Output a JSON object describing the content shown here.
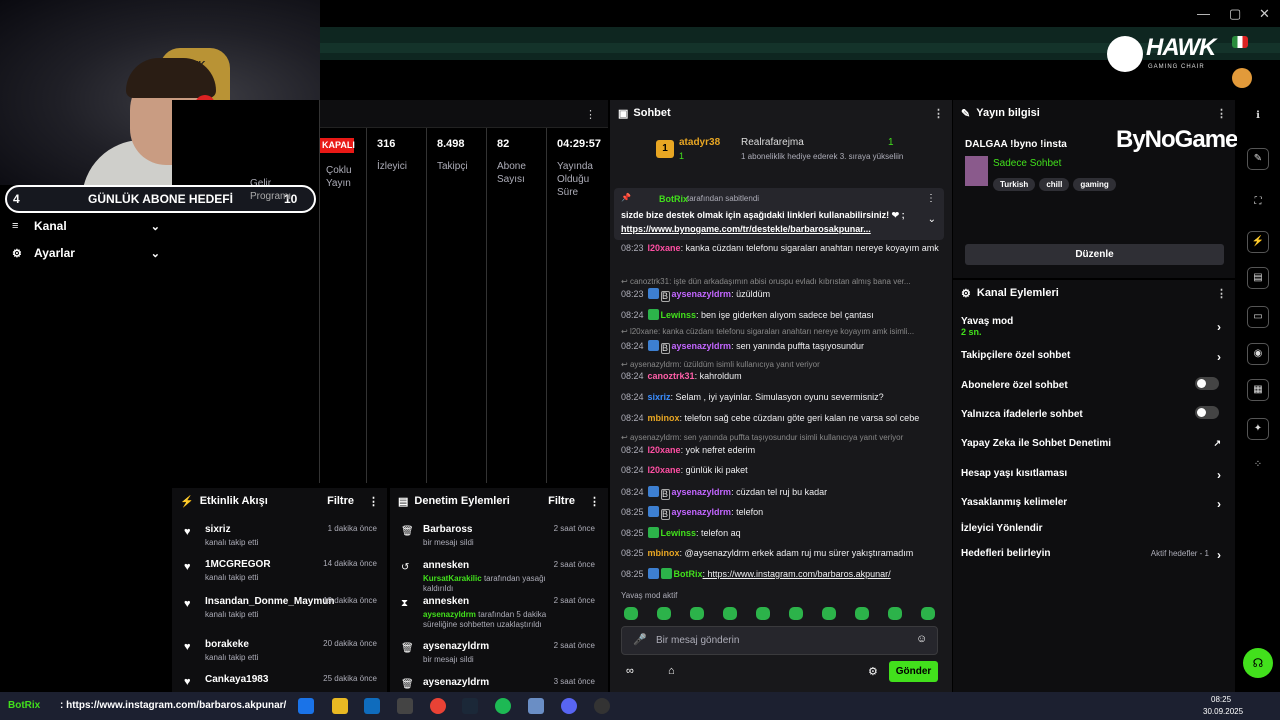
{
  "window": {
    "minimize": "—",
    "maximize": "▢",
    "close": "✕"
  },
  "brand": {
    "hawk": "HAWK",
    "hawk_sub": "GAMING CHAIR",
    "bynogame": "ByNoGame",
    "chair_text": "HAWK"
  },
  "goal": {
    "current": "4",
    "label": "GÜNLÜK ABONE HEDEFİ",
    "target": "10",
    "prog_hint": "Programı"
  },
  "sidebar": {
    "items": [
      {
        "label": "Kanal"
      },
      {
        "label": "Ayarlar"
      }
    ]
  },
  "stats": {
    "status": "KAPALI",
    "income_hint": "Gelir",
    "multi_stream": "Çoklu Yayın",
    "viewers": {
      "value": "316",
      "label": "İzleyici"
    },
    "followers": {
      "value": "8.498",
      "label": "Takipçi"
    },
    "subs": {
      "value": "82",
      "label": "Abone Sayısı"
    },
    "uptime": {
      "value": "04:29:57",
      "label": "Yayında Olduğu Süre"
    }
  },
  "chat": {
    "title": "Sohbet",
    "top_user": "atadyr38",
    "top_rank": "1",
    "top_count": "1",
    "gift_user": "Realrafarejma",
    "gift_count": "1",
    "gift_text": "1 aboneliklik hediye ederek 3. sıraya yükseliin",
    "pinned_by": "BotRix",
    "pinned_suffix": "tarafından sabitlendi",
    "pinned_text": "sizde bize destek olmak için aşağıdaki linkleri kullanabilirsiniz! ❤ ;",
    "pinned_link": "https://www.bynogame.com/tr/destekle/barbarosakpunar...",
    "slow_mode": "Yavaş mod aktif",
    "placeholder": "Bir mesaj gönderin",
    "send": "Gönder",
    "messages": [
      {
        "time": "08:23",
        "user": "l20xane",
        "text": ": kanka cüzdanı telefonu sigaraları anahtarı nereye koyayım amk"
      },
      {
        "reply": "canoztrk31: işte dün arkadaşımın abisi oruspu evladı kıbrıstan almış bana ver..."
      },
      {
        "time": "08:23",
        "user": "aysenazyldrm",
        "text": ": üzüldüm"
      },
      {
        "time": "08:24",
        "user": "Lewinss",
        "text": ": ben işe giderken alıyom sadece bel çantası"
      },
      {
        "reply": "l20xane: kanka cüzdanı telefonu sigaraları anahtarı nereye koyayım amk isimli..."
      },
      {
        "time": "08:24",
        "user": "aysenazyldrm",
        "text": ": sen yanında puffta taşıyosundur"
      },
      {
        "reply": "aysenazyldrm: üzüldüm isimli kullanıcıya yanıt veriyor"
      },
      {
        "time": "08:24",
        "user": "canoztrk31",
        "text": ": kahroldum"
      },
      {
        "time": "08:24",
        "user": "sixriz",
        "text": ": Selam , iyi yayinlar. Simulasyon oyunu severmisniz?"
      },
      {
        "time": "08:24",
        "user": "mbinox",
        "text": ": telefon sağ cebe cüzdanı göte geri kalan ne varsa sol cebe"
      },
      {
        "reply": "aysenazyldrm: sen yanında puffta taşıyosundur isimli kullanıcıya yanıt veriyor"
      },
      {
        "time": "08:24",
        "user": "l20xane",
        "text": ": yok nefret ederim"
      },
      {
        "time": "08:24",
        "user": "l20xane",
        "text": ": günlük iki paket"
      },
      {
        "time": "08:24",
        "user": "aysenazyldrm",
        "text": ": cüzdan tel ruj bu kadar"
      },
      {
        "time": "08:25",
        "user": "aysenazyldrm",
        "text": ": telefon"
      },
      {
        "time": "08:25",
        "user": "Lewinss",
        "text": ": telefon aq"
      },
      {
        "time": "08:25",
        "user": "mbinox",
        "text": ": @aysenazyldrm erkek adam ruj mu sürer yakıştıramadım"
      },
      {
        "time": "08:25",
        "user": "BotRix",
        "text": ": https://www.instagram.com/barbaros.akpunar/"
      }
    ]
  },
  "activity": {
    "title": "Etkinlik Akışı",
    "filter": "Filtre",
    "items": [
      {
        "name": "sixriz",
        "desc": "kanalı takip etti",
        "time": "1 dakika önce"
      },
      {
        "name": "1MCGREGOR",
        "desc": "kanalı takip etti",
        "time": "14 dakika önce"
      },
      {
        "name": "Insandan_Donme_Maymun",
        "desc": "kanalı takip etti",
        "time": "19 dakika önce"
      },
      {
        "name": "borakeke",
        "desc": "kanalı takip etti",
        "time": "20 dakika önce"
      },
      {
        "name": "Cankaya1983",
        "desc": "",
        "time": "25 dakika önce"
      }
    ]
  },
  "moderation": {
    "title": "Denetim Eylemleri",
    "filter": "Filtre",
    "items": [
      {
        "name": "Barbaross",
        "desc": "bir mesajı sildi",
        "extra": "",
        "time": "2 saat önce"
      },
      {
        "name": "annesken",
        "extra": "KursatKarakilic",
        "desc": "tarafından yasağı kaldırıldı",
        "time": "2 saat önce"
      },
      {
        "name": "annesken",
        "extra": "aysenazyldrm",
        "desc": "tarafından 5 dakika süreliğine sohbetten uzaklaştırıldı",
        "time": "2 saat önce"
      },
      {
        "name": "aysenazyldrm",
        "desc": "bir mesajı sildi",
        "extra": "",
        "time": "2 saat önce"
      },
      {
        "name": "aysenazyldrm",
        "desc": "",
        "extra": "",
        "time": "3 saat önce"
      }
    ]
  },
  "stream_info": {
    "title": "Yayın bilgisi",
    "stream_title": "DALGAA !byno !insta",
    "category": "Sadece Sohbet",
    "tags": [
      "Turkish",
      "chill",
      "gaming"
    ],
    "edit": "Düzenle"
  },
  "channel_actions": {
    "title": "Kanal Eylemleri",
    "items": [
      {
        "label": "Yavaş mod",
        "sub": "2 sn."
      },
      {
        "label": "Takipçilere özel sohbet",
        "sub": ""
      },
      {
        "label": "Abonelere özel sohbet",
        "sub": ""
      },
      {
        "label": "Yalnızca ifadelerle sohbet",
        "sub": ""
      },
      {
        "label": "Yapay Zeka ile Sohbet Denetimi",
        "sub": ""
      },
      {
        "label": "Hesap yaşı kısıtlaması",
        "sub": ""
      },
      {
        "label": "Yasaklanmış kelimeler",
        "sub": ""
      },
      {
        "label": "İzleyici Yönlendir",
        "sub": ""
      },
      {
        "label": "Hedefleri belirleyin",
        "sub": ""
      }
    ],
    "goals_status": "Aktif hedefler - 1"
  },
  "ticker": {
    "text": ": https://www.instagram.com/barbaros.akpunar/",
    "user": "BotRix"
  },
  "clock": {
    "time": "08:25",
    "date": "30.09.2025"
  },
  "colors": {
    "accent": "#42e01c",
    "live": "#e91916",
    "panel": "#0e0e10"
  }
}
